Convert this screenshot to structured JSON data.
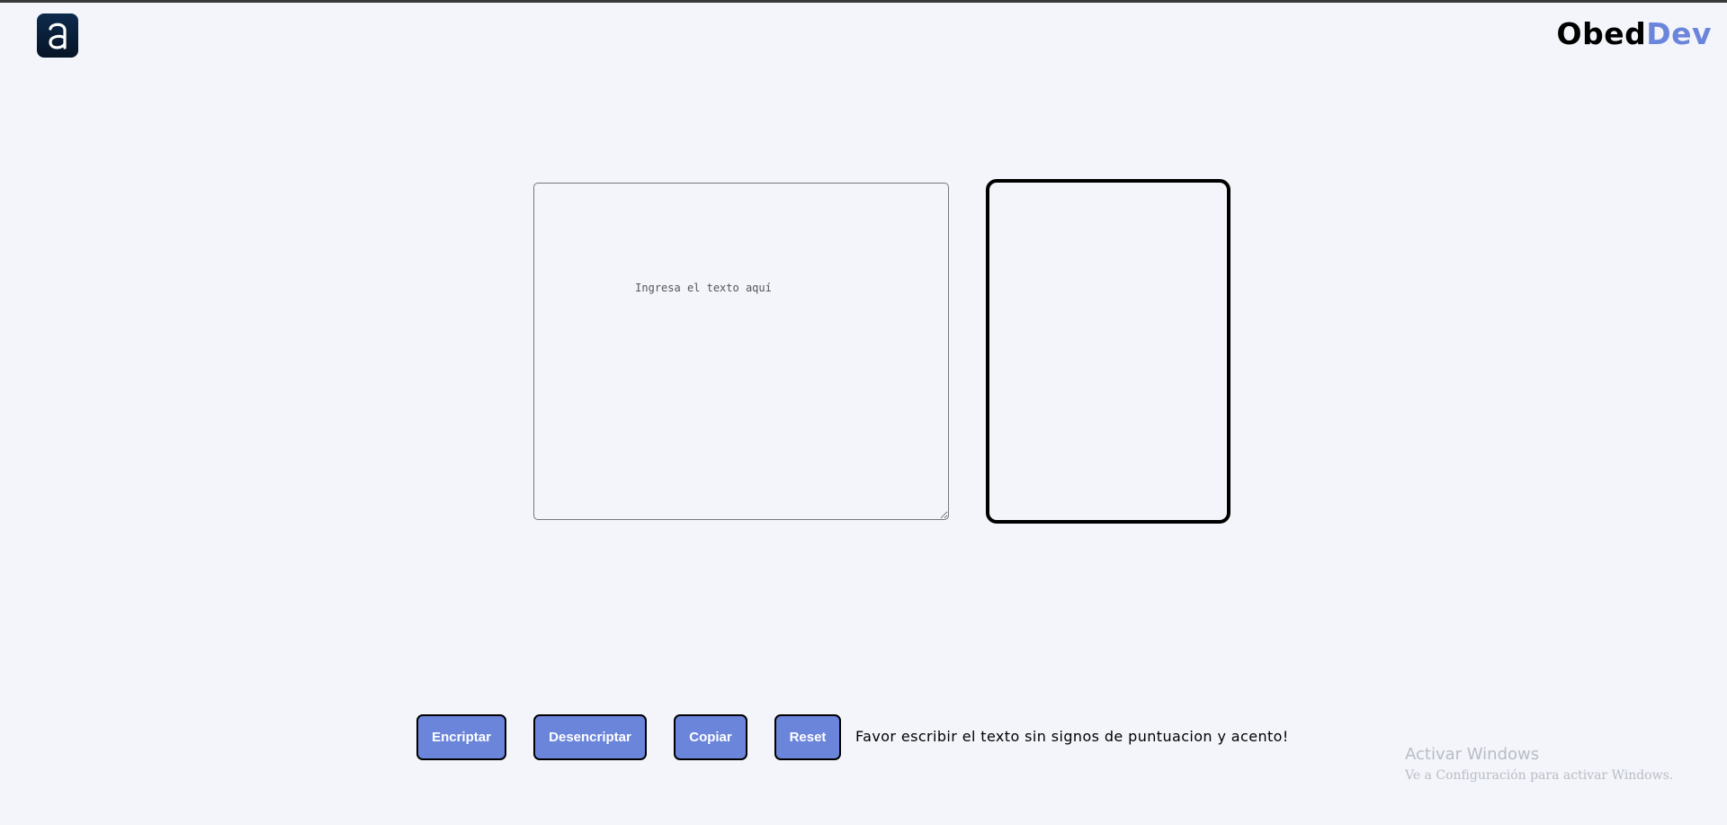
{
  "header": {
    "logo_icon": "letter-a-logo-icon",
    "brand_part1": "Obed",
    "brand_part2": "Dev",
    "brand_accent": "#6b85db"
  },
  "editor": {
    "input_placeholder": "Ingresa el texto aquí",
    "input_value": "",
    "output_value": ""
  },
  "actions": {
    "encrypt_label": "Encriptar",
    "decrypt_label": "Desencriptar",
    "copy_label": "Copiar",
    "reset_label": "Reset",
    "button_color": "#6b85db"
  },
  "notice": "Favor escribir el texto sin signos de puntuacion y acento!",
  "watermark": {
    "title": "Activar Windows",
    "subtitle": "Ve a Configuración para activar Windows."
  }
}
